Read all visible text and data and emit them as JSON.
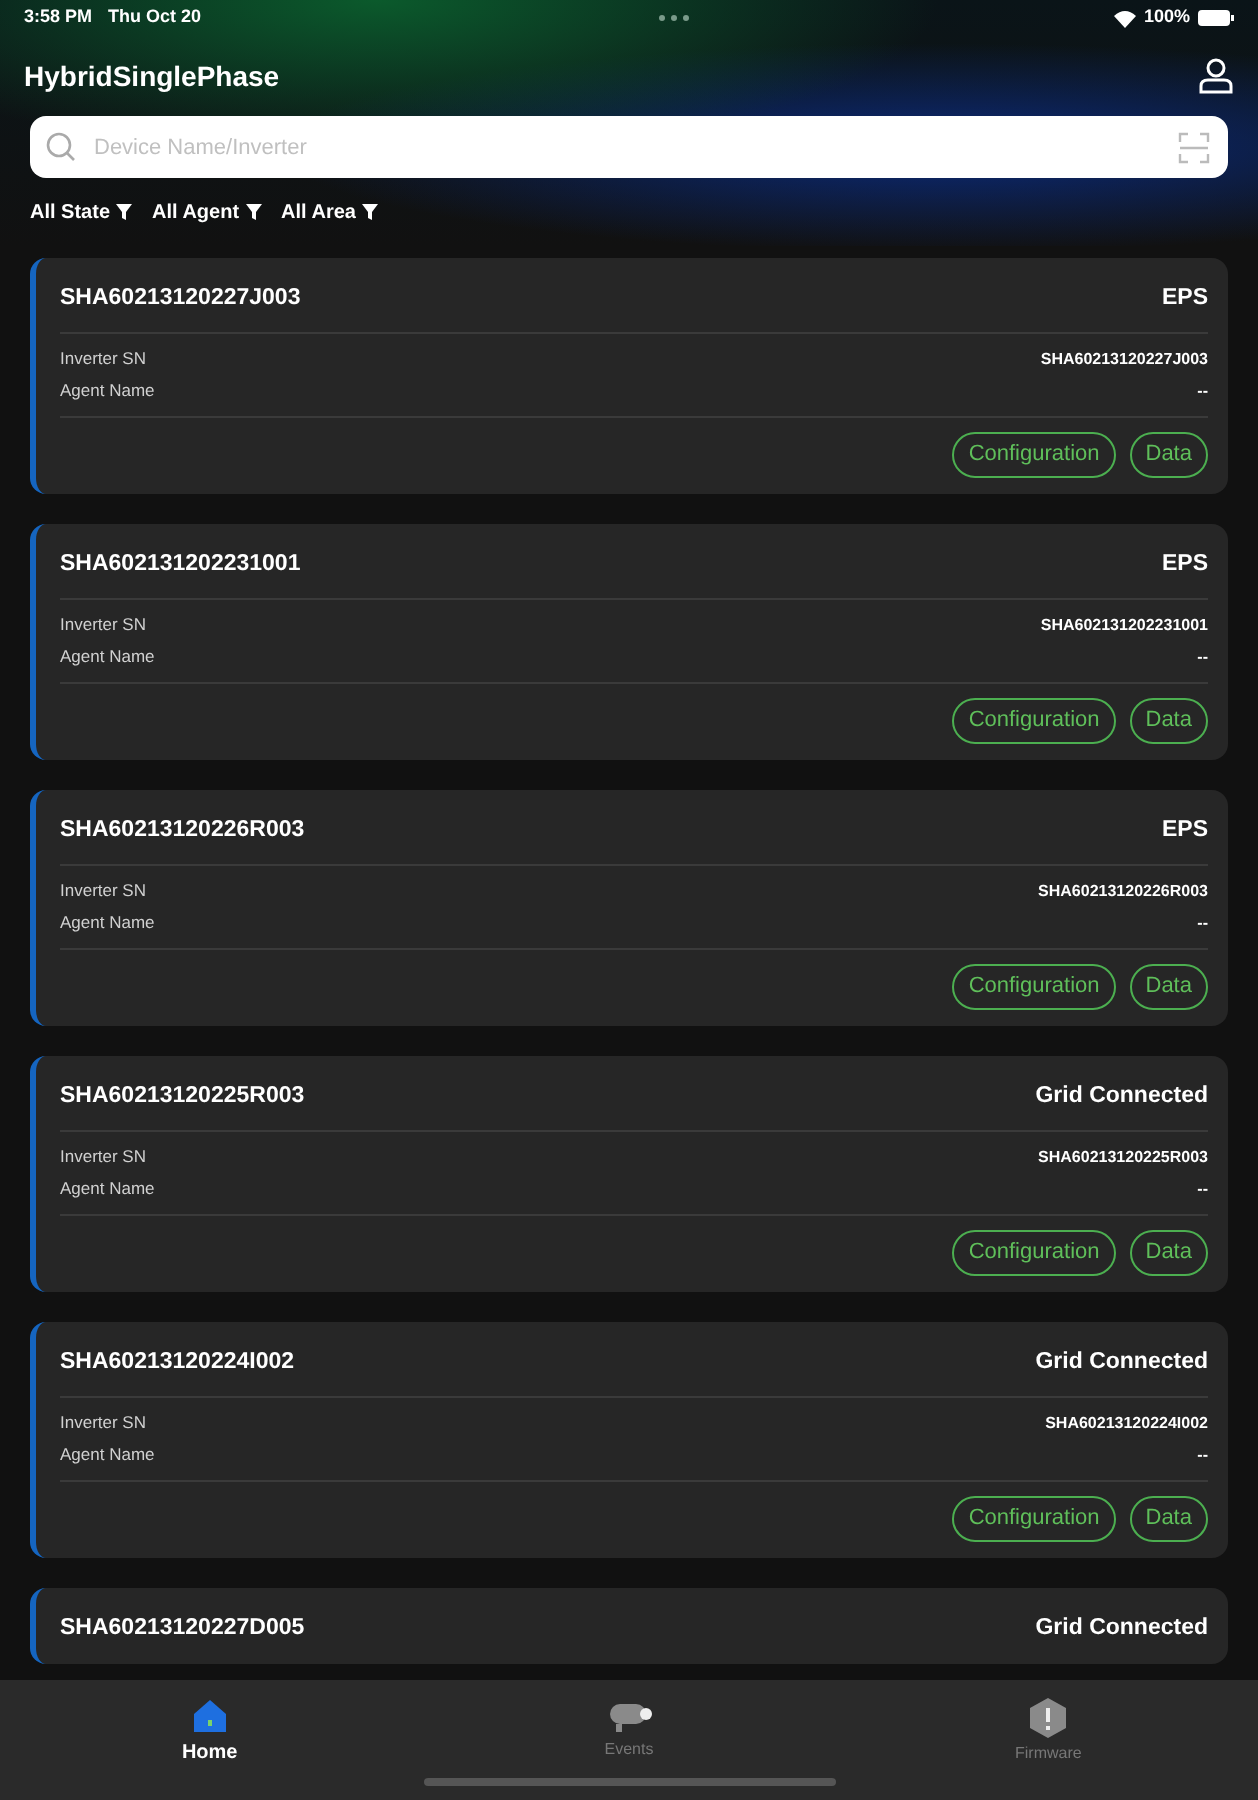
{
  "status_bar": {
    "time": "3:58 PM",
    "date": "Thu Oct 20",
    "battery": "100%"
  },
  "header": {
    "title": "HybridSinglePhase"
  },
  "search": {
    "placeholder": "Device Name/Inverter"
  },
  "filters": [
    "All State",
    "All Agent",
    "All Area"
  ],
  "devices": [
    {
      "name": "SHA60213120227J003",
      "status": "EPS",
      "inverter_sn_label": "Inverter SN",
      "inverter_sn": "SHA60213120227J003",
      "agent_label": "Agent Name",
      "agent": "--",
      "actions": [
        "Configuration",
        "Data"
      ]
    },
    {
      "name": "SHA602131202231001",
      "status": "EPS",
      "inverter_sn_label": "Inverter SN",
      "inverter_sn": "SHA602131202231001",
      "agent_label": "Agent Name",
      "agent": "--",
      "actions": [
        "Configuration",
        "Data"
      ]
    },
    {
      "name": "SHA60213120226R003",
      "status": "EPS",
      "inverter_sn_label": "Inverter SN",
      "inverter_sn": "SHA60213120226R003",
      "agent_label": "Agent Name",
      "agent": "--",
      "actions": [
        "Configuration",
        "Data"
      ]
    },
    {
      "name": "SHA60213120225R003",
      "status": "Grid Connected",
      "inverter_sn_label": "Inverter SN",
      "inverter_sn": "SHA60213120225R003",
      "agent_label": "Agent Name",
      "agent": "--",
      "actions": [
        "Configuration",
        "Data"
      ]
    },
    {
      "name": "SHA60213120224I002",
      "status": "Grid Connected",
      "inverter_sn_label": "Inverter SN",
      "inverter_sn": "SHA60213120224I002",
      "agent_label": "Agent Name",
      "agent": "--",
      "actions": [
        "Configuration",
        "Data"
      ]
    },
    {
      "name": "SHA60213120227D005",
      "status": "Grid Connected"
    }
  ],
  "tabs": [
    {
      "label": "Home",
      "kind": "home",
      "selected": true
    },
    {
      "label": "Events",
      "kind": "events",
      "selected": false
    },
    {
      "label": "Firmware",
      "kind": "firmware",
      "selected": false
    }
  ]
}
